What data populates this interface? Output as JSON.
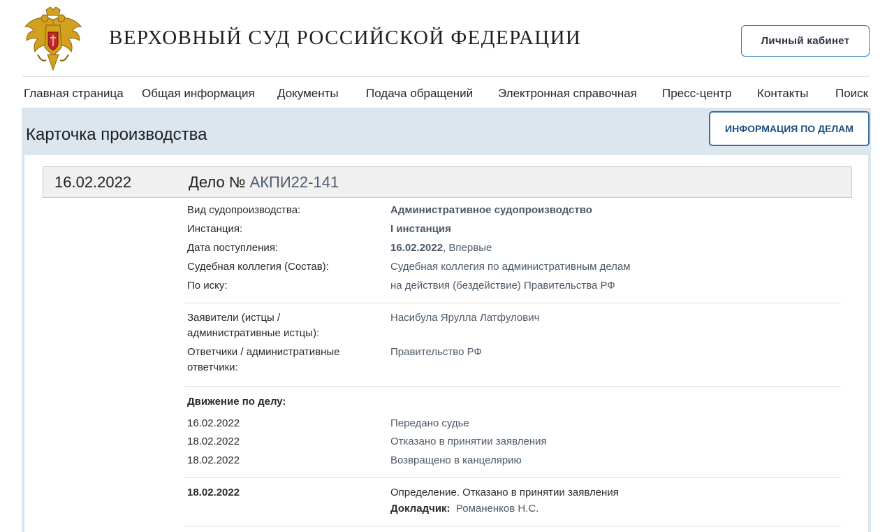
{
  "header": {
    "site_title": "ВЕРХОВНЫЙ СУД РОССИЙСКОЙ ФЕДЕРАЦИИ",
    "cabinet_button": "Личный кабинет",
    "emblem_icon": "coat-of-arms-icon"
  },
  "nav": {
    "items": [
      {
        "label": "Главная страница"
      },
      {
        "label": "Общая информация"
      },
      {
        "label": "Документы"
      },
      {
        "label": "Подача обращений"
      },
      {
        "label": "Электронная справочная"
      },
      {
        "label": "Пресс-центр"
      },
      {
        "label": "Контакты"
      },
      {
        "label": "Поиск"
      }
    ]
  },
  "page": {
    "title": "Карточка производства",
    "info_button": "ИНФОРМАЦИЯ ПО ДЕЛАМ"
  },
  "case": {
    "date": "16.02.2022",
    "title_prefix": "Дело №",
    "number": "АКПИ22-141",
    "details": [
      {
        "label": "Вид судопроизводства:",
        "value": "Административное судопроизводство"
      },
      {
        "label": "Инстанция:",
        "value": "I инстанция"
      },
      {
        "label": "Дата поступления:",
        "value_bold": "16.02.2022",
        "value_rest": ", Впервые"
      },
      {
        "label": "Судебная коллегия (Состав):",
        "value": "Судебная коллегия по административным делам"
      },
      {
        "label": "По иску:",
        "value": "на действия (бездействие) Правительства РФ"
      }
    ],
    "parties": [
      {
        "label_line1": "Заявители (истцы /",
        "label_line2": "административные истцы):",
        "value": "Насибула Ярулла Латфулович"
      },
      {
        "label_line1": "Ответчики / административные",
        "label_line2": "ответчики:",
        "value": "Правительство РФ"
      }
    ],
    "movement_title": "Движение по делу:",
    "movement": [
      {
        "date": "16.02.2022",
        "event": "Передано судье"
      },
      {
        "date": "18.02.2022",
        "event": "Отказано в принятии заявления"
      },
      {
        "date": "18.02.2022",
        "event": "Возвращено в канцелярию"
      }
    ],
    "decision": {
      "date": "18.02.2022",
      "type": "Определение.",
      "text": " Отказано в принятии заявления",
      "reporter_label": "Докладчик:",
      "reporter_name": "Романенков Н.С."
    }
  },
  "colors": {
    "band": "#dce6ef",
    "accent_blue": "#1c4e80",
    "value_gray_blue": "#4b5a69"
  }
}
